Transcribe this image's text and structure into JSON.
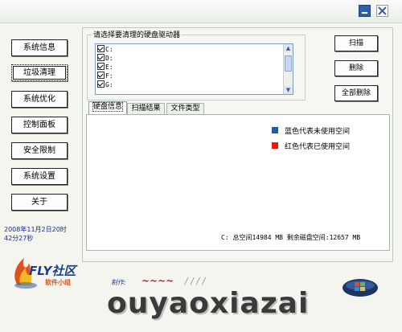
{
  "nav": {
    "items": [
      {
        "label": "系统信息"
      },
      {
        "label": "垃圾清理"
      },
      {
        "label": "系统优化"
      },
      {
        "label": "控制面板"
      },
      {
        "label": "安全限制"
      },
      {
        "label": "系统设置"
      },
      {
        "label": "关于"
      }
    ],
    "active": "垃圾清理",
    "datetime_line1": "2008年11月2日20时",
    "datetime_line2": "42分27秒"
  },
  "drives": {
    "group_label": "请选择要清理的硬盘驱动器",
    "items": [
      {
        "label": "C:",
        "checked": true
      },
      {
        "label": "D:",
        "checked": true
      },
      {
        "label": "E:",
        "checked": true
      },
      {
        "label": "F:",
        "checked": true
      },
      {
        "label": "G:",
        "checked": true
      }
    ]
  },
  "actions": {
    "scan": "扫描",
    "delete": "删除",
    "delete_all": "全部删除"
  },
  "tabs": [
    {
      "label": "硬盘信息",
      "active": true
    },
    {
      "label": "扫描结果",
      "active": false
    },
    {
      "label": "文件类型",
      "active": false
    }
  ],
  "disk_info": {
    "legend": [
      {
        "label": "蓝色代表未使用空间",
        "color": "#1f5aa6"
      },
      {
        "label": "红色代表已使用空间",
        "color": "#ff1010"
      }
    ],
    "summary": "C: 总空间14984 MB 剩余磁盘空间:12657 MB"
  },
  "branding": {
    "logo_text": "FLY社区",
    "logo_sub": "软件小组",
    "made_by": "制作:",
    "watermark": "ouyaoxiazai",
    "icons": [
      "minimize-icon",
      "close-icon",
      "windows-orb-icon",
      "fly-logo"
    ]
  }
}
